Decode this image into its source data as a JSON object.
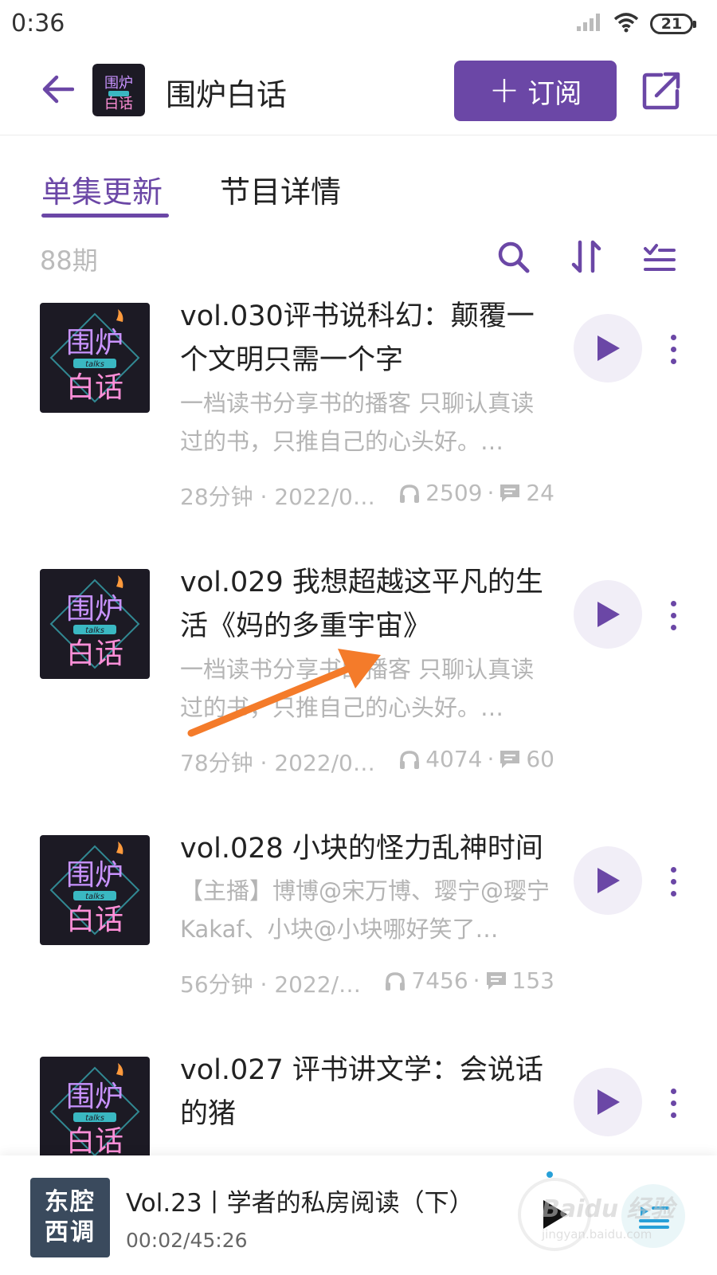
{
  "status_bar": {
    "time": "0:36",
    "battery": "21",
    "icons": [
      "signal-icon",
      "wifi-icon",
      "battery-icon"
    ]
  },
  "header": {
    "title": "围炉白话",
    "subscribe_label": "订阅",
    "icons": [
      "back-arrow-icon",
      "share-icon"
    ]
  },
  "tabs": [
    {
      "label": "单集更新",
      "active": true
    },
    {
      "label": "节目详情",
      "active": false
    }
  ],
  "toolbar": {
    "episode_count": "88期",
    "icons": [
      "search-icon",
      "sort-icon",
      "multi-select-icon"
    ]
  },
  "episodes": [
    {
      "title": "vol.030评书说科幻：颠覆一个文明只需一个字",
      "description": "一档读书分享书的播客 只聊认真读过的书，只推自己的心头好。…",
      "duration_date": "28分钟 · 2022/0…",
      "plays": "2509",
      "comments": "24"
    },
    {
      "title": "vol.029 我想超越这平凡的生活《妈的多重宇宙》",
      "description": "一档读书分享书的播客 只聊认真读过的书，只推自己的心头好。…",
      "duration_date": "78分钟 · 2022/0…",
      "plays": "4074",
      "comments": "60"
    },
    {
      "title": "vol.028 小块的怪力乱神时间",
      "description": "【主播】博博@宋万博、璎宁@璎宁Kakaf、小块@小块哪好笑了…",
      "duration_date": "56分钟 · 2022/…",
      "plays": "7456",
      "comments": "153"
    },
    {
      "title": "vol.027 评书讲文学：会说话的猪",
      "description": "",
      "duration_date": "",
      "plays": "",
      "comments": ""
    }
  ],
  "cover_art": {
    "line1": "围炉",
    "badge": "talks",
    "line2": "白话"
  },
  "mini_player": {
    "cover_text_line1": "东腔",
    "cover_text_line2": "西调",
    "title": "Vol.23丨学者的私房阅读（下）",
    "time": "00:02/45:26"
  },
  "watermark": {
    "logo": "Baidu 经验",
    "url": "jingyan.baidu.com"
  },
  "colors": {
    "accent": "#6b47a6",
    "annotation_arrow": "#f47b2a",
    "player_progress": "#27a0d8"
  }
}
